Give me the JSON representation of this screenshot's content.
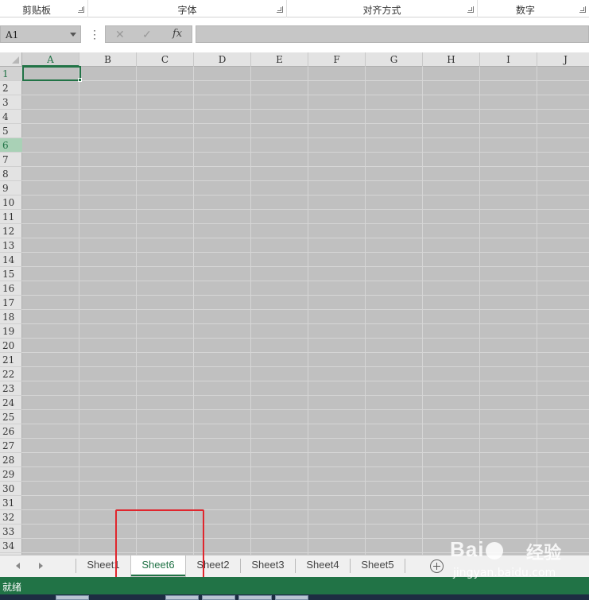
{
  "ribbon": {
    "groups": [
      {
        "label": "剪贴板"
      },
      {
        "label": "字体"
      },
      {
        "label": "对齐方式"
      },
      {
        "label": "数字"
      }
    ]
  },
  "formula_bar": {
    "name_box_value": "A1",
    "more_icon": "⋮",
    "cancel_icon": "✕",
    "enter_icon": "✓",
    "fx_label": "fx",
    "formula_value": ""
  },
  "grid": {
    "columns": [
      "A",
      "B",
      "C",
      "D",
      "E",
      "F",
      "G",
      "H",
      "I",
      "J"
    ],
    "rows": [
      "1",
      "2",
      "3",
      "4",
      "5",
      "6",
      "7",
      "8",
      "9",
      "10",
      "11",
      "12",
      "13",
      "14",
      "15",
      "16",
      "17",
      "18",
      "19",
      "20",
      "21",
      "22",
      "23",
      "24",
      "25",
      "26",
      "27",
      "28",
      "29",
      "30",
      "31",
      "32",
      "33",
      "34"
    ],
    "active_cell": "A1",
    "highlighted_row": "6"
  },
  "sheet_tabs": {
    "tabs": [
      "Sheet1",
      "Sheet6",
      "Sheet2",
      "Sheet3",
      "Sheet4",
      "Sheet5"
    ],
    "active": "Sheet6"
  },
  "status_bar": {
    "text": "就绪"
  },
  "watermark": {
    "brand": "Bai",
    "brand_cn": "经验",
    "url": "jingyan.baidu.com"
  },
  "colors": {
    "accent": "#217346",
    "highlight_box": "#e0262d",
    "grid_background": "#c0c0c0"
  }
}
